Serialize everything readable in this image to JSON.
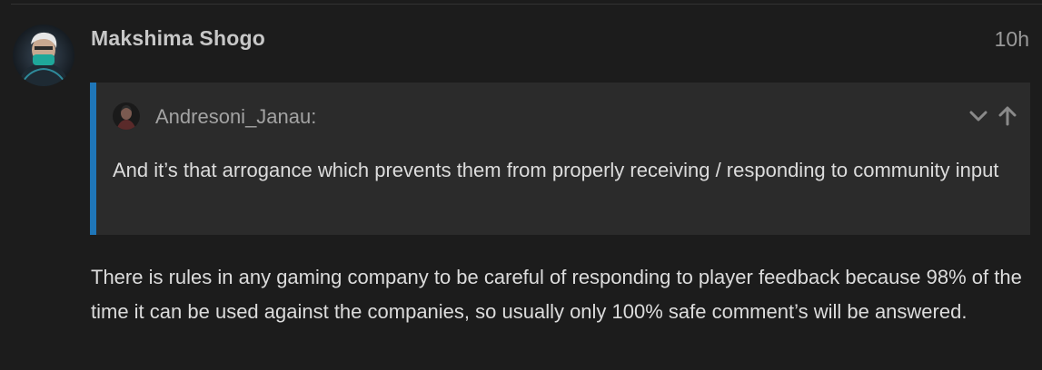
{
  "post": {
    "author": "Makshima Shogo",
    "date": "10h",
    "quote": {
      "author": "Andresoni_Janau:",
      "text": "And it’s that arrogance which prevents them from properly receiving / responding to community input",
      "expand_icon": "chevron-down-icon",
      "goto_icon": "arrow-up-icon"
    },
    "body": "There is rules in any gaming company to be careful of responding to player feedback because 98% of the time it can be used against the companies, so usually only 100% safe comment’s will be answered."
  },
  "colors": {
    "background": "#1c1c1c",
    "quote_background": "#2b2b2b",
    "quote_accent": "#1f76b8",
    "text": "#dcdcdc",
    "muted_text": "#9a9a9a"
  }
}
